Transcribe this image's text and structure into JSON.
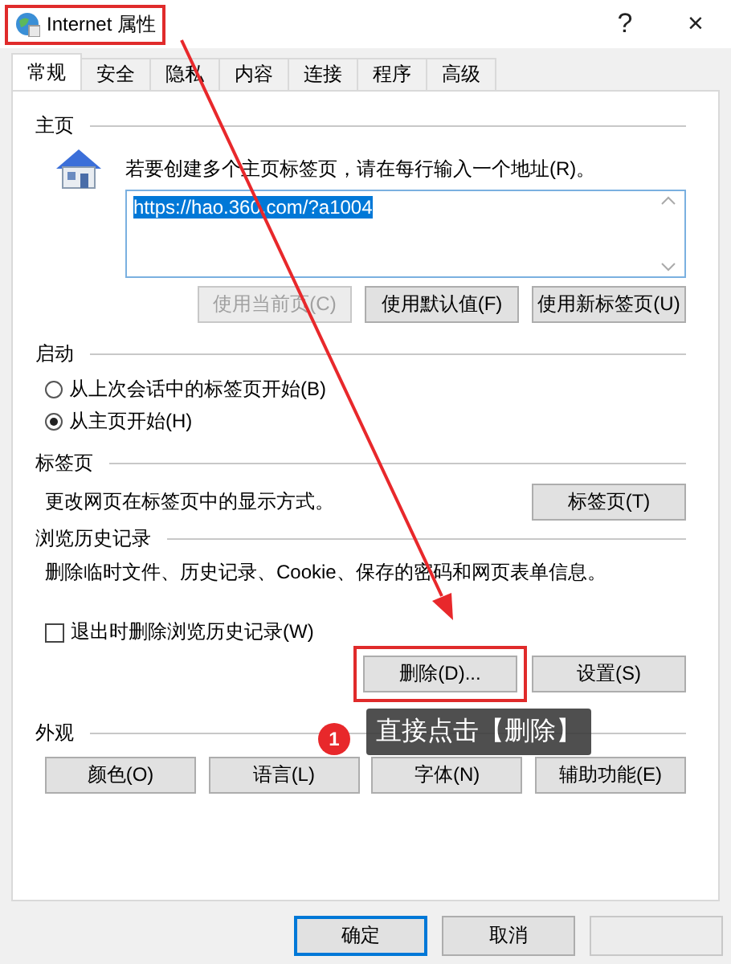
{
  "window": {
    "title": "Internet 属性",
    "title_highlighted": true,
    "help": "?",
    "close": "×"
  },
  "tabs": [
    {
      "label": "常规",
      "selected": true
    },
    {
      "label": "安全",
      "selected": false
    },
    {
      "label": "隐私",
      "selected": false
    },
    {
      "label": "内容",
      "selected": false
    },
    {
      "label": "连接",
      "selected": false
    },
    {
      "label": "程序",
      "selected": false
    },
    {
      "label": "高级",
      "selected": false
    }
  ],
  "home": {
    "heading": "主页",
    "instruction": "若要创建多个主页标签页，请在每行输入一个地址(R)。",
    "url": "https://hao.360.com/?a1004",
    "url_selected": true,
    "buttons": [
      {
        "label": "使用当前页(C)",
        "disabled": true
      },
      {
        "label": "使用默认值(F)",
        "disabled": false
      },
      {
        "label": "使用新标签页(U)",
        "disabled": false
      }
    ]
  },
  "startup": {
    "heading": "启动",
    "options": [
      {
        "label": "从上次会话中的标签页开始(B)",
        "selected": false
      },
      {
        "label": "从主页开始(H)",
        "selected": true
      }
    ]
  },
  "tab_settings": {
    "heading": "标签页",
    "description": "更改网页在标签页中的显示方式。",
    "button": "标签页(T)"
  },
  "history": {
    "heading": "浏览历史记录",
    "description": "删除临时文件、历史记录、Cookie、保存的密码和网页表单信息。",
    "delete_on_exit": {
      "label": "退出时删除浏览历史记录(W)",
      "checked": false
    },
    "buttons": [
      {
        "label": "删除(D)...",
        "highlighted": true
      },
      {
        "label": "设置(S)",
        "highlighted": false
      }
    ]
  },
  "appearance": {
    "heading": "外观",
    "buttons": [
      "颜色(O)",
      "语言(L)",
      "字体(N)",
      "辅助功能(E)"
    ]
  },
  "footer_buttons": [
    {
      "label": "确定",
      "focused": true
    },
    {
      "label": "取消",
      "focused": false
    }
  ],
  "annotation": {
    "badge": "1",
    "tooltip": "直接点击【删除】"
  }
}
